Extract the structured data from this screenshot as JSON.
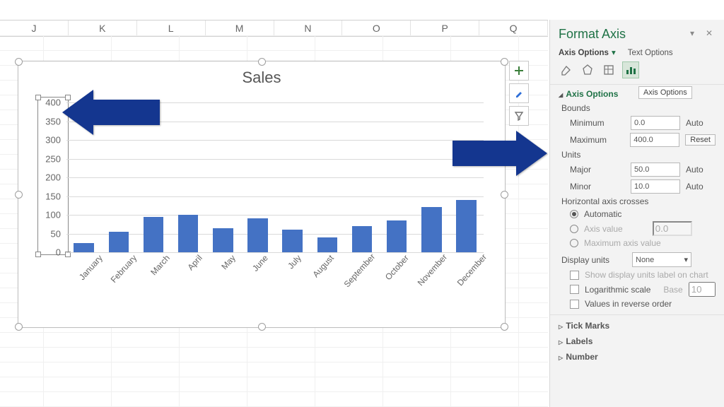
{
  "columns": [
    "J",
    "K",
    "L",
    "M",
    "N",
    "O",
    "P",
    "Q"
  ],
  "chart_data": {
    "type": "bar",
    "title": "Sales",
    "categories": [
      "January",
      "February",
      "March",
      "April",
      "May",
      "June",
      "July",
      "August",
      "September",
      "October",
      "November",
      "December"
    ],
    "values": [
      25,
      55,
      95,
      100,
      65,
      90,
      60,
      40,
      70,
      85,
      120,
      140
    ],
    "ylim": [
      0,
      400
    ],
    "ymajor": 50,
    "yticks": [
      400,
      350,
      300,
      250,
      200,
      150,
      100,
      50,
      0
    ],
    "xlabel": "",
    "ylabel": ""
  },
  "chart_buttons": {
    "plus": "+",
    "brush": "🖌",
    "funnel": "⏷"
  },
  "pane": {
    "title": "Format Axis",
    "tabs": {
      "axis": "Axis Options",
      "text": "Text Options"
    },
    "icon_tooltip": "Axis Options",
    "sections": {
      "axis_options": "Axis Options",
      "bounds": "Bounds",
      "min_label": "Minimum",
      "min_value": "0.0",
      "min_mode": "Auto",
      "max_label": "Maximum",
      "max_value": "400.0",
      "max_mode": "Reset",
      "units": "Units",
      "major_label": "Major",
      "major_value": "50.0",
      "major_mode": "Auto",
      "minor_label": "Minor",
      "minor_value": "10.0",
      "minor_mode": "Auto",
      "crosses": "Horizontal axis crosses",
      "cross_auto": "Automatic",
      "cross_val": "Axis value",
      "cross_val_value": "0.0",
      "cross_max": "Maximum axis value",
      "display_units": "Display units",
      "display_units_value": "None",
      "show_units_label": "Show display units label on chart",
      "log_scale": "Logarithmic scale",
      "log_base_label": "Base",
      "log_base_value": "10",
      "reverse": "Values in reverse order",
      "tick_marks": "Tick Marks",
      "labels": "Labels",
      "number": "Number"
    }
  }
}
